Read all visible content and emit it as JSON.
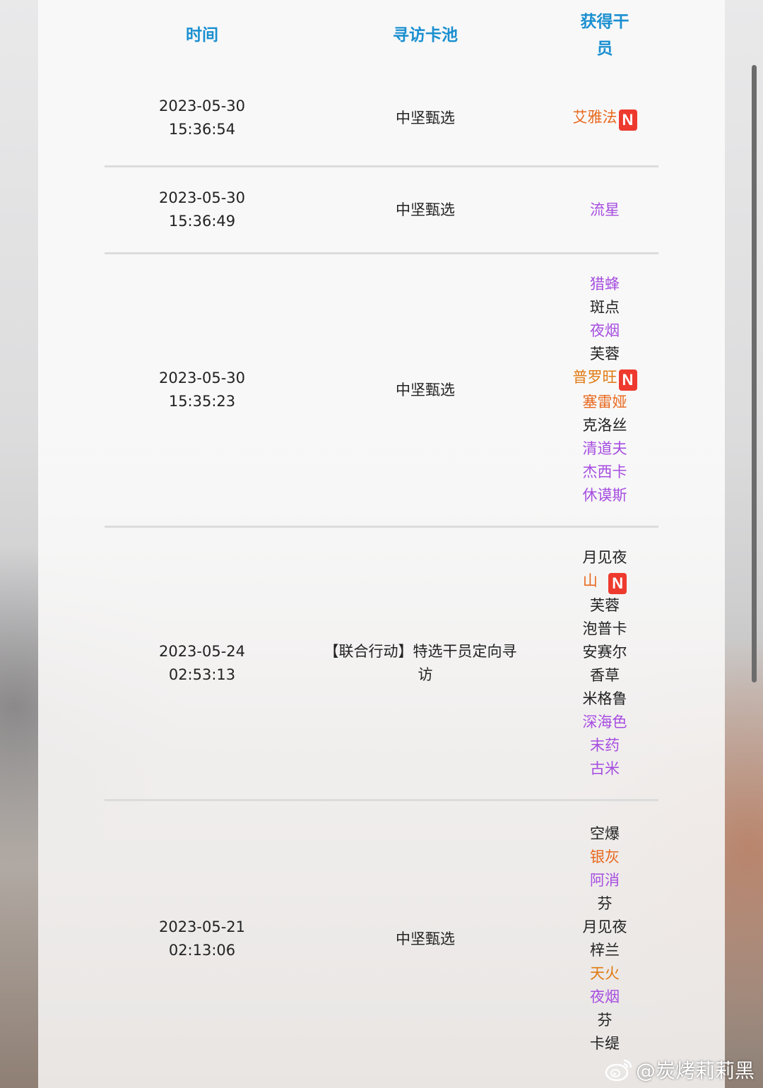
{
  "header": {
    "time": "时间",
    "pool": "寻访卡池",
    "operators": "获得干员"
  },
  "new_badge": "N",
  "colors": {
    "rarity3": "#222222",
    "rarity4": "#a64de0",
    "rarity5": "#e07a12",
    "rarity6": "#e8681e",
    "header": "#1a8fd0",
    "badge": "#ee3a2e"
  },
  "rows": [
    {
      "date": "2023-05-30",
      "clock": "15:36:54",
      "pool": "中坚甄选",
      "ops": [
        {
          "name": "艾雅法",
          "rarity": 6,
          "new": true
        }
      ]
    },
    {
      "date": "2023-05-30",
      "clock": "15:36:49",
      "pool": "中坚甄选",
      "ops": [
        {
          "name": "流星",
          "rarity": 4,
          "new": false
        }
      ]
    },
    {
      "date": "2023-05-30",
      "clock": "15:35:23",
      "pool": "中坚甄选",
      "ops": [
        {
          "name": "猎蜂",
          "rarity": 4,
          "new": false
        },
        {
          "name": "斑点",
          "rarity": 3,
          "new": false
        },
        {
          "name": "夜烟",
          "rarity": 4,
          "new": false
        },
        {
          "name": "芙蓉",
          "rarity": 3,
          "new": false
        },
        {
          "name": "普罗旺",
          "rarity": 5,
          "new": true
        },
        {
          "name": "塞雷娅",
          "rarity": 6,
          "new": false
        },
        {
          "name": "克洛丝",
          "rarity": 3,
          "new": false
        },
        {
          "name": "清道夫",
          "rarity": 4,
          "new": false
        },
        {
          "name": "杰西卡",
          "rarity": 4,
          "new": false
        },
        {
          "name": "休谟斯",
          "rarity": 4,
          "new": false
        }
      ]
    },
    {
      "date": "2023-05-24",
      "clock": "02:53:13",
      "pool_line1": "【联合行动】特选干员定向寻",
      "pool_line2": "访",
      "op1_line1": "月见夜",
      "op1_line2": "山",
      "ops": [
        {
          "name": "芙蓉",
          "rarity": 3,
          "new": false
        },
        {
          "name": "泡普卡",
          "rarity": 3,
          "new": false
        },
        {
          "name": "安赛尔",
          "rarity": 3,
          "new": false
        },
        {
          "name": "香草",
          "rarity": 3,
          "new": false
        },
        {
          "name": "米格鲁",
          "rarity": 3,
          "new": false
        },
        {
          "name": "深海色",
          "rarity": 4,
          "new": false
        },
        {
          "name": "末药",
          "rarity": 4,
          "new": false
        },
        {
          "name": "古米",
          "rarity": 4,
          "new": false
        }
      ]
    },
    {
      "date": "2023-05-21",
      "clock": "02:13:06",
      "pool": "中坚甄选",
      "ops": [
        {
          "name": "空爆",
          "rarity": 3,
          "new": false
        },
        {
          "name": "银灰",
          "rarity": 6,
          "new": false
        },
        {
          "name": "阿消",
          "rarity": 4,
          "new": false
        },
        {
          "name": "芬",
          "rarity": 3,
          "new": false
        },
        {
          "name": "月见夜",
          "rarity": 3,
          "new": false
        },
        {
          "name": "梓兰",
          "rarity": 3,
          "new": false
        },
        {
          "name": "天火",
          "rarity": 5,
          "new": false
        },
        {
          "name": "夜烟",
          "rarity": 4,
          "new": false
        },
        {
          "name": "芬",
          "rarity": 3,
          "new": false
        },
        {
          "name": "卡缇",
          "rarity": 3,
          "new": false
        }
      ]
    }
  ],
  "watermark": "@炭烤莉莉黑"
}
